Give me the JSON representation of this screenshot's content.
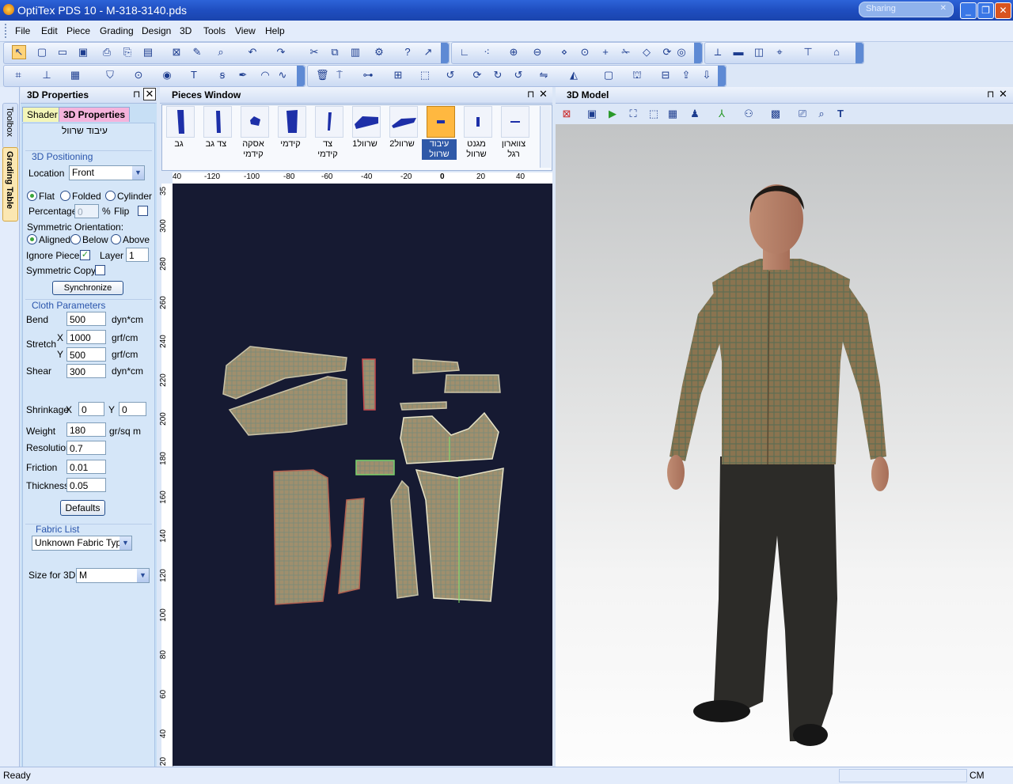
{
  "window": {
    "title": "OptiTex PDS 10 - M-318-3140.pds",
    "sharing": "Sharing",
    "min": "_",
    "restore": "❐",
    "close": "✕"
  },
  "menu": [
    "File",
    "Edit",
    "Piece",
    "Grading",
    "Design",
    "3D",
    "Tools",
    "View",
    "Help"
  ],
  "side_tabs": {
    "toolbox": "Toolbox",
    "grading": "Grading Table"
  },
  "props_panel": {
    "title": "3D Properties",
    "tabs": [
      "Shader",
      "3D Properties"
    ],
    "piece_name": "עיבוד שרוול",
    "positioning": {
      "group": "3D Positioning",
      "location_label": "Location",
      "location_value": "Front",
      "flat": "Flat",
      "folded": "Folded",
      "cylinder": "Cylinder",
      "percentage_label": "Percentage",
      "percentage_value": "0",
      "percent_sign": "%",
      "flip_label": "Flip",
      "sym_orient_label": "Symmetric Orientation:",
      "aligned": "Aligned",
      "below": "Below",
      "above": "Above",
      "ignore_label": "Ignore Piece",
      "layer_label": "Layer",
      "layer_value": "1",
      "sym_copy_label": "Symmetric Copy",
      "sync_button": "Synchronize"
    },
    "cloth": {
      "group": "Cloth Parameters",
      "bend_label": "Bend",
      "bend_value": "500",
      "bend_unit": "dyn*cm",
      "stretch_label": "Stretch",
      "x_label": "X",
      "stretch_x": "1000",
      "stretch_x_unit": "grf/cm",
      "y_label": "Y",
      "stretch_y": "500",
      "stretch_y_unit": "grf/cm",
      "shear_label": "Shear",
      "shear_value": "300",
      "shear_unit": "dyn*cm",
      "shrink_label": "Shrinkage",
      "shrink_x_label": "X",
      "shrink_x": "0",
      "shrink_y_label": "Y",
      "shrink_y": "0",
      "weight_label": "Weight",
      "weight_value": "180",
      "weight_unit": "gr/sq m",
      "resolution_label": "Resolution",
      "resolution_value": "0.7",
      "friction_label": "Friction",
      "friction_value": "0.01",
      "thickness_label": "Thickness",
      "thickness_value": "0.05",
      "defaults_button": "Defaults"
    },
    "fabric": {
      "group": "Fabric List",
      "value": "Unknown Fabric Type"
    },
    "size": {
      "label": "Size for 3D",
      "value": "M"
    }
  },
  "pieces_window": {
    "title": "Pieces Window",
    "pieces": [
      {
        "cap1": "גב",
        "cap2": ""
      },
      {
        "cap1": "צד גב",
        "cap2": ""
      },
      {
        "cap1": "אסקה",
        "cap2": "קידמי"
      },
      {
        "cap1": "קידמי",
        "cap2": ""
      },
      {
        "cap1": "צד",
        "cap2": "קידמי"
      },
      {
        "cap1": "שרוול1",
        "cap2": ""
      },
      {
        "cap1": "שרוול2",
        "cap2": ""
      },
      {
        "cap1": "עיבוד",
        "cap2": "שרוול"
      },
      {
        "cap1": "מגנט",
        "cap2": "שרוול"
      },
      {
        "cap1": "צווארון",
        "cap2": "רגל"
      }
    ],
    "ruler_top": [
      "40",
      "-120",
      "-100",
      "-80",
      "-60",
      "-40",
      "-20",
      "0",
      "20",
      "40"
    ],
    "ruler_left": [
      "35",
      "300",
      "280",
      "260",
      "240",
      "220",
      "200",
      "180",
      "160",
      "140",
      "120",
      "100",
      "80",
      "60",
      "40",
      "20"
    ]
  },
  "model_window": {
    "title": "3D Model"
  },
  "status": {
    "text": "Ready",
    "unit": "CM"
  }
}
